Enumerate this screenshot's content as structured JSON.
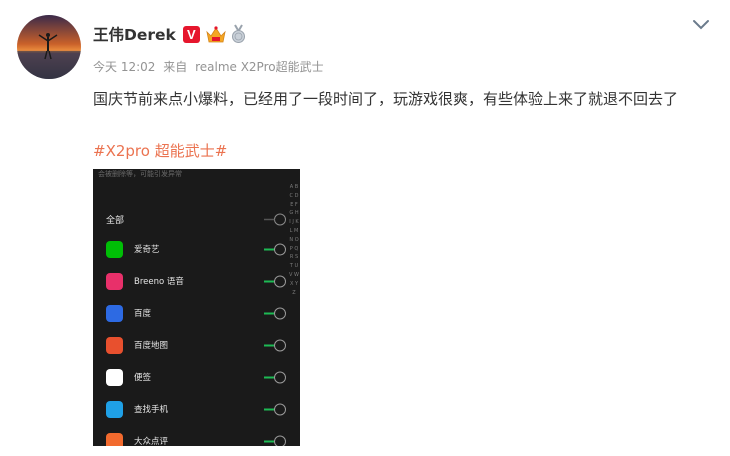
{
  "post": {
    "author": "王伟Derek",
    "verified_badge": "V",
    "time": "今天 12:02",
    "source_prefix": "来自",
    "source": "realme X2Pro超能武士",
    "text": "国庆节前来点小爆料，已经用了一段时间了，玩游戏很爽，有些体验上来了就退不回去了",
    "topic": "#X2pro 超能武士#"
  },
  "icons": {
    "menu": "chevron-down-icon",
    "crown": "crown-badge-icon",
    "medal": "medal-badge-icon"
  },
  "screenshot": {
    "header_text": "会被删除等，可能引发异常",
    "all_label": "全部",
    "apps": [
      {
        "label": "爱奇艺",
        "icon": "iqiyi-icon",
        "color": "#00be06",
        "enabled": true
      },
      {
        "label": "Breeno 语音",
        "icon": "breeno-icon",
        "color": "#e8306a",
        "enabled": true
      },
      {
        "label": "百度",
        "icon": "baidu-icon",
        "color": "#2d6ae3",
        "enabled": true
      },
      {
        "label": "百度地图",
        "icon": "baidu-map-icon",
        "color": "#e8502e",
        "enabled": true
      },
      {
        "label": "便签",
        "icon": "notes-icon",
        "color": "#ffffff",
        "enabled": true
      },
      {
        "label": "查找手机",
        "icon": "find-phone-icon",
        "color": "#1fa0e6",
        "enabled": true
      },
      {
        "label": "大众点评",
        "icon": "dianping-icon",
        "color": "#f26a2e",
        "enabled": true
      }
    ],
    "alphabet": "A B C D E F G H I J K L M N O P Q R S T U V W X Y Z"
  },
  "colors": {
    "text": "#333333",
    "meta": "#939393",
    "topic": "#eb7350",
    "verified": "#e6162d",
    "toggle_on": "#1db954"
  }
}
